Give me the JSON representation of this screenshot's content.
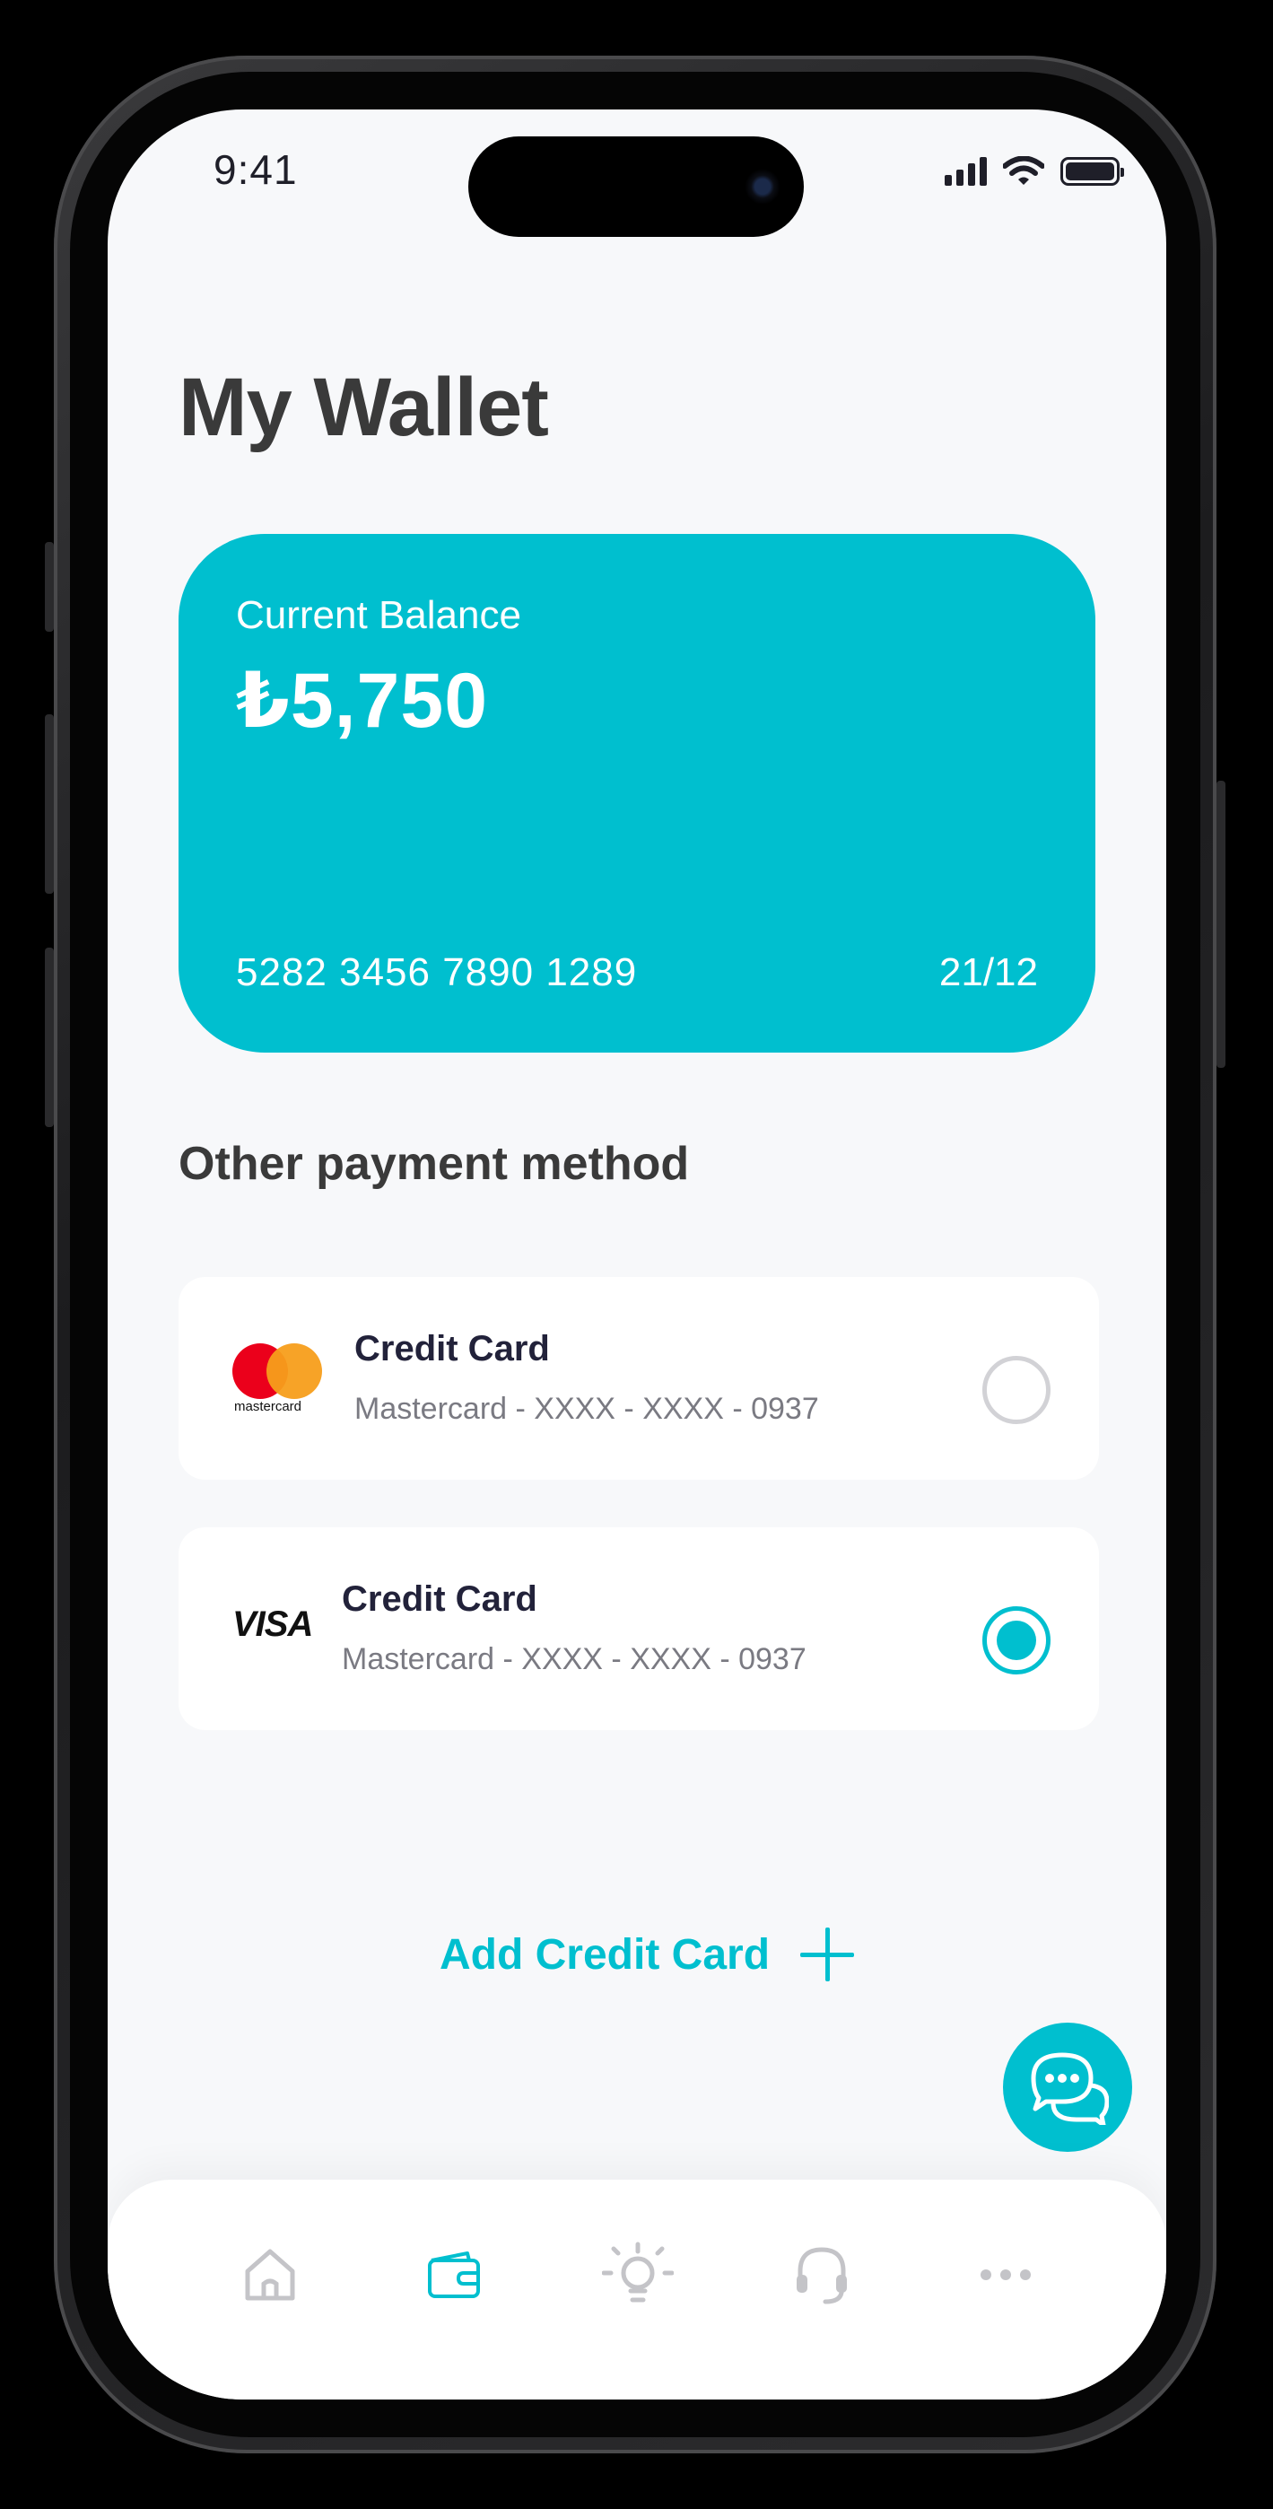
{
  "status_bar": {
    "time": "9:41"
  },
  "page": {
    "title": "My Wallet"
  },
  "balance_card": {
    "label": "Current Balance",
    "amount": "₺5,750",
    "card_number": "5282 3456 7890 1289",
    "expiry": "21/12",
    "color": "#00bfcf"
  },
  "other_methods": {
    "title": "Other payment method",
    "items": [
      {
        "brand": "mastercard",
        "brand_text": "mastercard",
        "title": "Credit Card",
        "subtitle": "Mastercard - XXXX - XXXX  - 0937",
        "selected": false
      },
      {
        "brand": "visa",
        "brand_text": "VISA",
        "title": "Credit Card",
        "subtitle": "Mastercard - XXXX - XXXX  - 0937",
        "selected": true
      }
    ]
  },
  "add_card": {
    "label": "Add Credit Card"
  },
  "tabbar": {
    "items": [
      {
        "icon": "home-icon",
        "active": false
      },
      {
        "icon": "wallet-icon",
        "active": true
      },
      {
        "icon": "lightbulb-icon",
        "active": false
      },
      {
        "icon": "headset-icon",
        "active": false
      },
      {
        "icon": "more-icon",
        "active": false
      }
    ]
  },
  "colors": {
    "accent": "#00bfcf",
    "text_dark": "#3a3a3a",
    "inactive_icon": "#c4c4c8"
  }
}
